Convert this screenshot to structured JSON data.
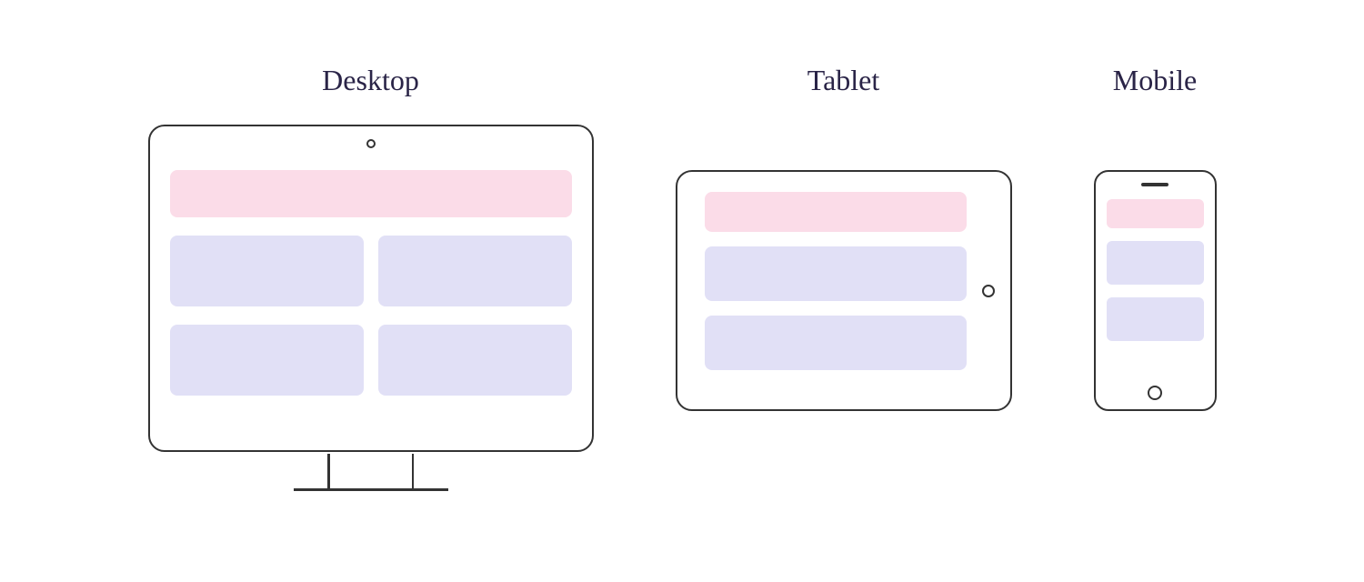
{
  "devices": {
    "desktop": {
      "label": "Desktop"
    },
    "tablet": {
      "label": "Tablet"
    },
    "mobile": {
      "label": "Mobile"
    }
  },
  "colors": {
    "header_block": "#fbdce8",
    "content_block": "#e1e0f6",
    "outline": "#333333",
    "label_text": "#2a2447"
  },
  "layout": {
    "desktop": {
      "header_rows": 1,
      "content_rows": 2,
      "content_columns": 2
    },
    "tablet": {
      "header_rows": 1,
      "content_rows": 2,
      "content_columns": 1
    },
    "mobile": {
      "header_rows": 1,
      "content_rows": 2,
      "content_columns": 1
    }
  }
}
